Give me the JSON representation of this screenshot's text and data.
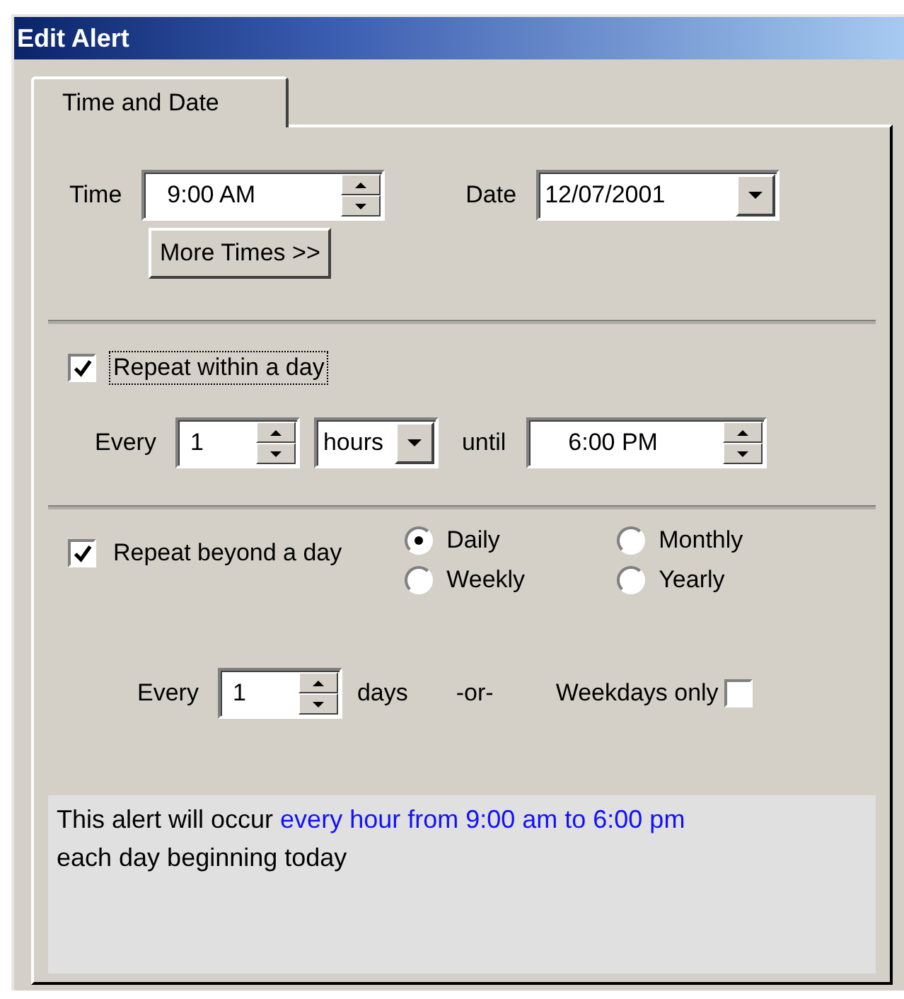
{
  "window": {
    "title": "Edit Alert"
  },
  "tabs": [
    {
      "label": "Time and Date",
      "selected": true
    }
  ],
  "time": {
    "label": "Time",
    "value": "9:00 AM"
  },
  "date": {
    "label": "Date",
    "value": "12/07/2001"
  },
  "more_times_button": "More Times >>",
  "repeat_within_day": {
    "label": "Repeat within a day",
    "checked": true,
    "focused": true,
    "every_label": "Every",
    "interval": "1",
    "unit": "hours",
    "until_label": "until",
    "until": "6:00 PM"
  },
  "repeat_beyond_day": {
    "label": "Repeat beyond a day",
    "checked": true,
    "frequencies": [
      {
        "label": "Daily",
        "selected": true
      },
      {
        "label": "Monthly",
        "selected": false
      },
      {
        "label": "Weekly",
        "selected": false
      },
      {
        "label": "Yearly",
        "selected": false
      }
    ],
    "every_label": "Every",
    "interval": "1",
    "unit_label": "days",
    "or_label": "-or-",
    "weekdays_only": {
      "label": "Weekdays only",
      "checked": false
    }
  },
  "summary": {
    "text": "This alert will occur ",
    "highlight": "every hour from 9:00 am to 6:00 pm",
    "rest": "each day beginning today"
  }
}
